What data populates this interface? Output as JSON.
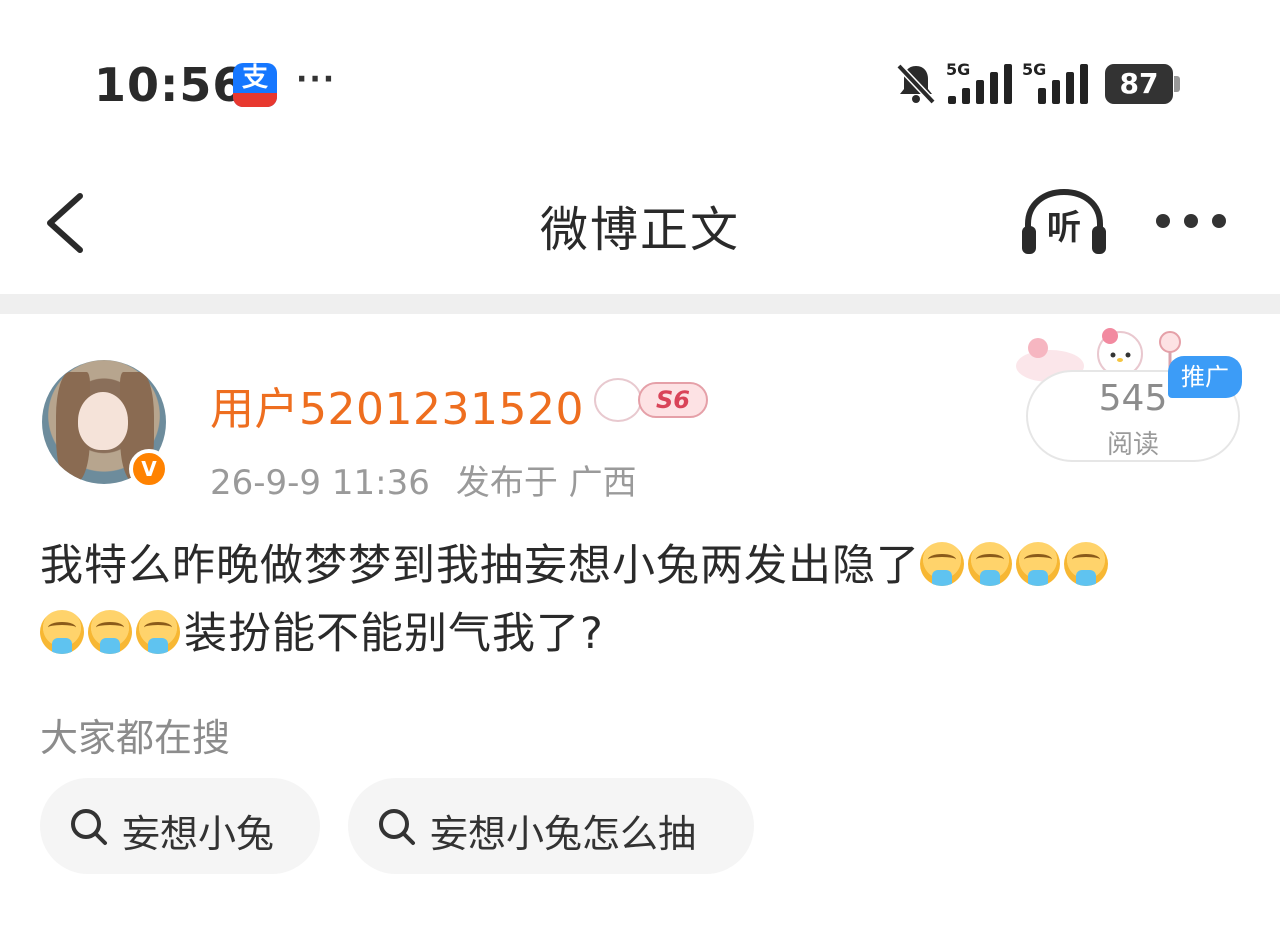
{
  "status_bar": {
    "time": "10:56",
    "app_icon": "alipay-icon",
    "app_icon_text": "支",
    "more": "···",
    "signal_1_label": "5G",
    "signal_2_label": "5G",
    "battery": "87"
  },
  "nav": {
    "back_icon": "chevron-left-icon",
    "title": "微博正文",
    "listen_label": "听",
    "more_icon": "more-horizontal-icon"
  },
  "post": {
    "username": "用户5201231520",
    "level": "S6",
    "timestamp": "26-9-9 11:36",
    "location": "发布于 广西",
    "verified_icon_text": "V",
    "read_count": "545",
    "read_label": "阅读",
    "promo_label": "推广",
    "text_line1": "我特么昨晚做梦梦到我抽妄想小兔两发出隐了",
    "text_line2": "装扮能不能别气我了?",
    "emoji_count_line1": 4,
    "emoji_count_line2": 3
  },
  "hot_search": {
    "label": "大家都在搜",
    "chips": [
      {
        "label": "妄想小兔"
      },
      {
        "label": "妄想小兔怎么抽"
      }
    ]
  },
  "colors": {
    "username": "#ee6e1f",
    "verified_badge": "#ff8200",
    "promo_tag": "#3c9cf7"
  }
}
